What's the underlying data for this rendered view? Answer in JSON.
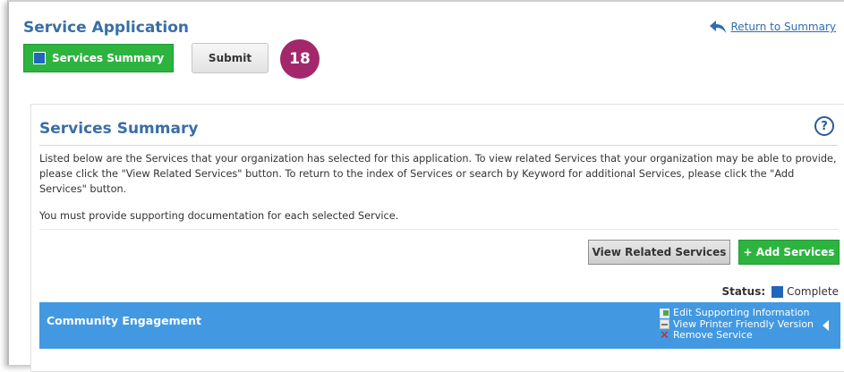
{
  "header": {
    "title": "Service Application",
    "return_link": "Return to Summary",
    "return_icon": "reply-arrow-icon"
  },
  "toolbar": {
    "summary_label": "Services Summary",
    "submit_label": "Submit",
    "step_badge": "18"
  },
  "panel": {
    "title": "Services Summary",
    "help_symbol": "?",
    "description": "Listed below are the Services that your organization has selected for this application. To view related Services that your organization may be able to provide, please click the \"View Related Services\" button. To return to the index of Services or search by Keyword for additional Services, please click the \"Add Services\" button.",
    "note": "You must provide supporting documentation for each selected Service.",
    "related_button": "View Related Services",
    "add_button": "+ Add Services"
  },
  "status": {
    "label": "Status:",
    "value": "Complete",
    "color": "#2266bb"
  },
  "services": [
    {
      "name": "Community Engagement",
      "actions": [
        {
          "label": "Edit Supporting Information",
          "icon": "edit-icon"
        },
        {
          "label": "View Printer Friendly Version",
          "icon": "printer-icon"
        },
        {
          "label": "Remove Service",
          "icon": "remove-x-icon"
        }
      ]
    }
  ],
  "colors": {
    "accent_green": "#2db43f",
    "title_blue": "#3a6ea5",
    "row_blue": "#4299e1",
    "badge_purple": "#a3286b"
  }
}
